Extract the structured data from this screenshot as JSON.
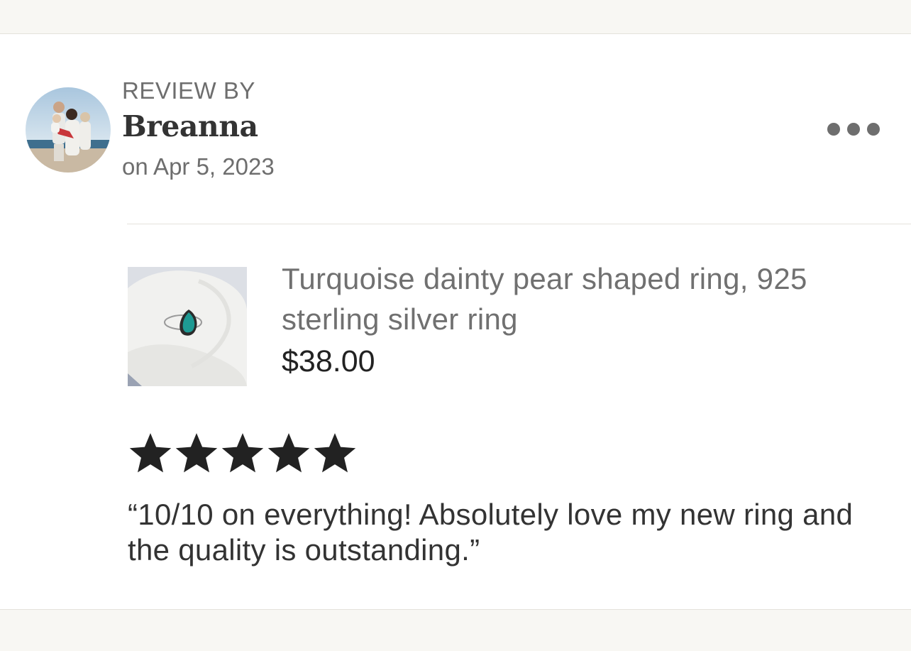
{
  "review": {
    "header_label": "REVIEW BY",
    "reviewer_name": "Breanna",
    "date": "on Apr 5, 2023",
    "rating": 5,
    "rating_max": 5,
    "text": "“10/10 on everything! Absolutely love my new ring and the quality is outstanding.”"
  },
  "product": {
    "title": "Turquoise dainty pear shaped ring, 925 sterling silver ring",
    "price": "$38.00"
  },
  "icons": {
    "more": "more-options-icon",
    "star": "star-icon"
  },
  "colors": {
    "background": "#f8f7f3",
    "card": "#ffffff",
    "star": "#222222",
    "muted_text": "#6e6e6e",
    "dots": "#6e6e6e",
    "stone": "#1e9a93"
  }
}
